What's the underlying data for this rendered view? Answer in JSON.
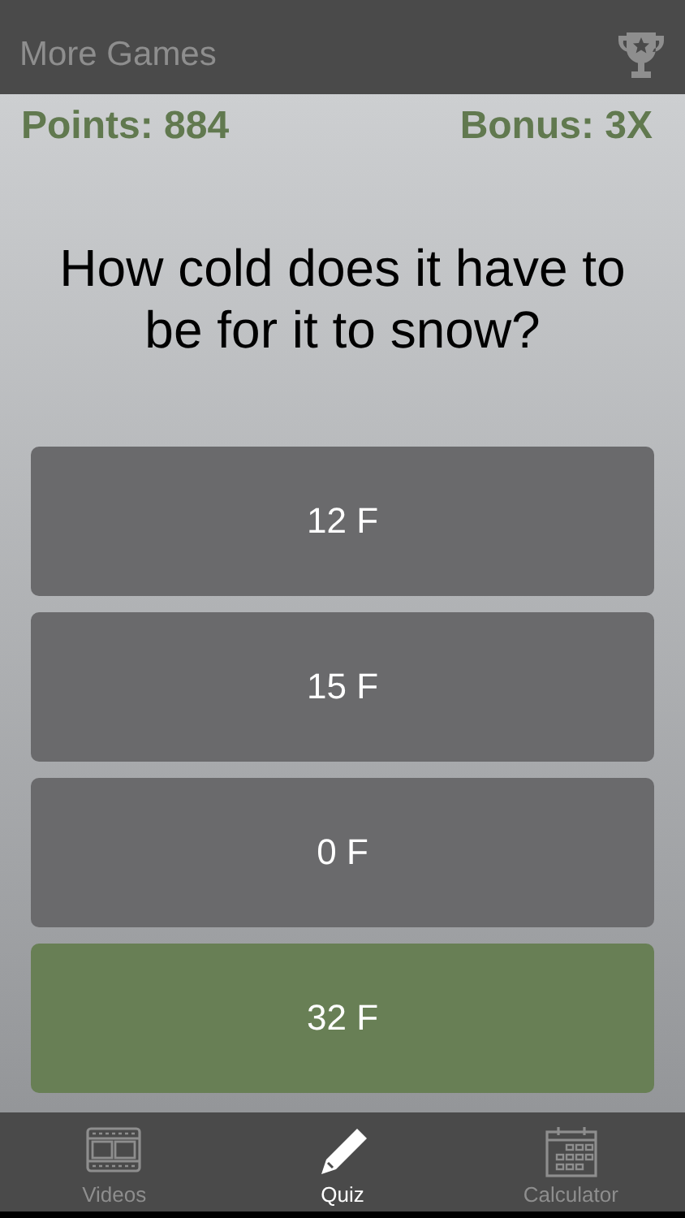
{
  "nav_bar": {
    "back_label": "More Games"
  },
  "score": {
    "points": "Points: 884",
    "bonus": "Bonus: 3X"
  },
  "question": "How cold does it have to be for it to snow?",
  "answers": [
    {
      "label": "12 F",
      "selected": false
    },
    {
      "label": "15 F",
      "selected": false
    },
    {
      "label": "0 F",
      "selected": false
    },
    {
      "label": "32 F",
      "selected": true
    }
  ],
  "tab_bar": [
    {
      "label": "Videos",
      "kind": "film",
      "selected": false
    },
    {
      "label": "Quiz",
      "kind": "pencil",
      "selected": true
    },
    {
      "label": "Calculator",
      "kind": "calendar",
      "selected": false
    }
  ]
}
